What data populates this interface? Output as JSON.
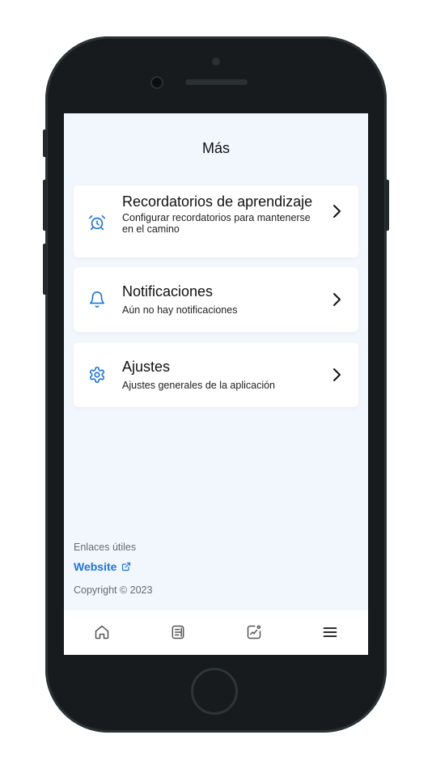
{
  "header": {
    "title": "Más"
  },
  "cards": [
    {
      "icon": "alarm-clock-icon",
      "title": "Recordatorios de aprendizaje",
      "subtitle": "Configurar recordatorios para mantenerse en el camino"
    },
    {
      "icon": "bell-icon",
      "title": "Notificaciones",
      "subtitle": "Aún no hay notificaciones"
    },
    {
      "icon": "gear-icon",
      "title": "Ajustes",
      "subtitle": "Ajustes generales de la aplicación"
    }
  ],
  "footer": {
    "label": "Enlaces útiles",
    "link_text": "Website",
    "copyright": "Copyright © 2023"
  },
  "tabbar": {
    "tabs": [
      "home-icon",
      "document-icon",
      "chart-icon",
      "menu-icon"
    ]
  },
  "colors": {
    "accent": "#1f74d6",
    "background": "#f2f6fd",
    "device": "#171b1d"
  }
}
